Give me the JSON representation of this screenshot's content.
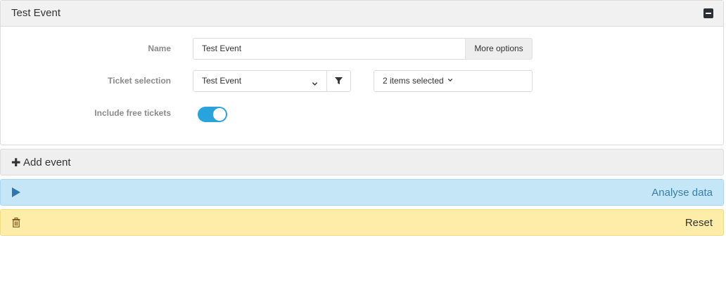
{
  "event": {
    "title": "Test Event",
    "name_label": "Name",
    "name_value": "Test Event",
    "more_options_label": "More options",
    "ticket_selection_label": "Ticket selection",
    "ticket_select_value": "Test Event",
    "items_select_value": "2 items selected",
    "include_free_tickets_label": "Include free tickets",
    "include_free_tickets_on": true
  },
  "actions": {
    "add_event_label": "Add event",
    "analyse_label": "Analyse data",
    "reset_label": "Reset"
  },
  "colors": {
    "accent": "#2aa3dd",
    "info_bg": "#c5e6f6",
    "warning_bg": "#fdeda8"
  },
  "icons": {
    "collapse": "minus-square-icon",
    "filter": "filter-icon",
    "add": "plus-icon",
    "analyse": "play-icon",
    "reset": "trash-icon"
  }
}
